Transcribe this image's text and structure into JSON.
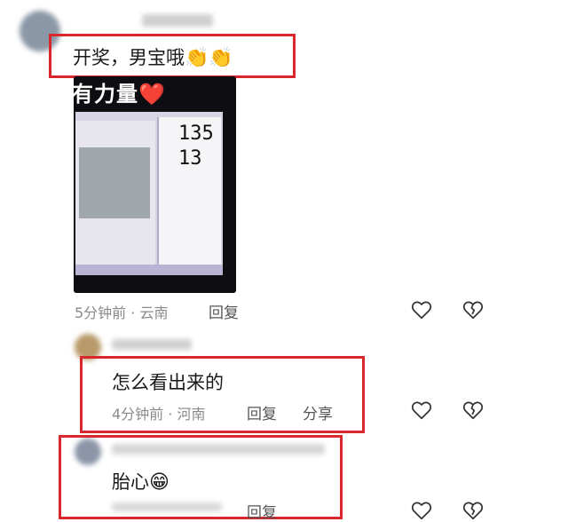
{
  "comments": [
    {
      "text": "开奖，男宝哦",
      "emoji": "👏👏",
      "image": {
        "caption": "有力量❤️",
        "readout_top": "135",
        "readout_bottom": "13"
      },
      "time": "5分钟前",
      "location": "云南",
      "reply_label": "回复"
    },
    {
      "text": "怎么看出来的",
      "time": "4分钟前",
      "location": "河南",
      "reply_label": "回复",
      "share_label": "分享"
    },
    {
      "text": "胎心",
      "emoji": "😁",
      "reply_label": "回复"
    }
  ],
  "colors": {
    "highlight_border": "#d9272e",
    "meta_text": "#8a8a8a"
  },
  "icons": {
    "like": "heart-outline-icon",
    "dislike": "broken-heart-icon"
  }
}
